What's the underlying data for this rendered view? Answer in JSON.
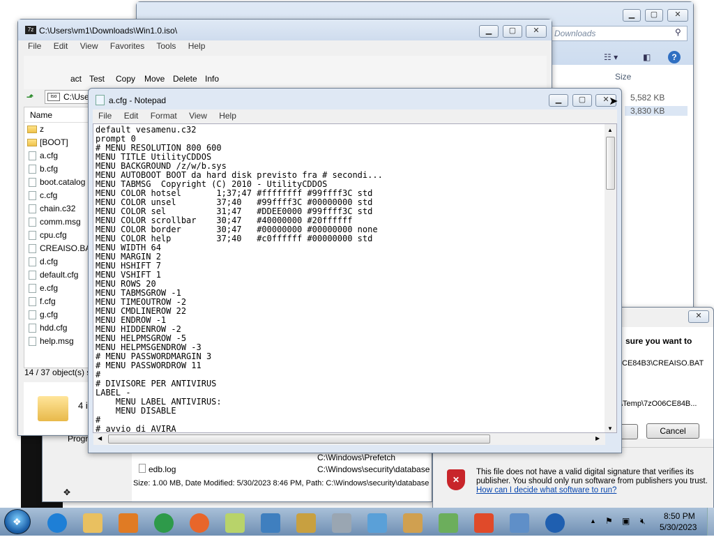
{
  "explorer": {
    "title": "C:\\Users\\vm1\\Downloads\\Win1.0.iso\\",
    "menu": [
      "File",
      "Edit",
      "View",
      "Favorites",
      "Tools",
      "Help"
    ],
    "toolbar": [
      "act",
      "Test",
      "Copy",
      "Move",
      "Delete",
      "Info"
    ],
    "path": "C:\\Use",
    "name_header": "Name",
    "files": [
      "z",
      "[BOOT]",
      "a.cfg",
      "b.cfg",
      "boot.catalog",
      "c.cfg",
      "chain.c32",
      "comm.msg",
      "cpu.cfg",
      "CREAISO.BAT",
      "d.cfg",
      "default.cfg",
      "e.cfg",
      "f.cfg",
      "g.cfg",
      "hdd.cfg",
      "help.msg"
    ],
    "status": "14 / 37 object(s) s",
    "bottom_text": "4 i"
  },
  "back_window": {
    "search_placeholder": "Downloads",
    "size_header": "Size",
    "sizes": [
      "5,582 KB",
      "3,830 KB"
    ]
  },
  "notepad": {
    "title": "a.cfg - Notepad",
    "menu": [
      "File",
      "Edit",
      "Format",
      "View",
      "Help"
    ],
    "content": "default vesamenu.c32\nprompt 0\n# MENU RESOLUTION 800 600\nMENU TITLE UtilityCDDOS\nMENU BACKGROUND /z/w/b.sys\nMENU AUTOBOOT BOOT da hard disk previsto fra # secondi...\nMENU TABMSG  Copyright (C) 2010 - UtilityCDDOS\nMENU COLOR hotsel       1;37;47 #ffffffff #99ffff3C std\nMENU COLOR unsel        37;40   #99ffff3C #00000000 std\nMENU COLOR sel          31;47   #DDEE0000 #99ffff3C std\nMENU COLOR scrollbar    30;47   #40000000 #20ffffff\nMENU COLOR border       30;47   #00000000 #00000000 none\nMENU COLOR help         37;40   #c0ffffff #00000000 std\nMENU WIDTH 64\nMENU MARGIN 2\nMENU HSHIFT 7\nMENU VSHIFT 1\nMENU ROWS 20\nMENU TABMSGROW -1\nMENU TIMEOUTROW -2\nMENU CMDLINEROW 22\nMENU ENDROW -1\nMENU HIDDENROW -2\nMENU HELPMSGROW -5\nMENU HELPMSGENDROW -3\n# MENU PASSWORDMARGIN 3\n# MENU PASSWORDROW 11\n#\n# DIVISORE PER ANTIVIRUS\nLABEL -\n    MENU LABEL ANTIVIRUS:\n    MENU DISABLE\n#\n# avvio di AVIRA"
  },
  "security_dialog": {
    "question": "sure you want to",
    "path1": "CE84B3\\CREAISO.BAT",
    "path2": "\\Temp\\7zO06CE84B...",
    "cancel": "Cancel",
    "warning": "This file does not have a valid digital signature that verifies its publisher.  You should only run software from publishers you trust.",
    "link": "How can I decide what software to run?"
  },
  "search_results": {
    "row_partial": "C:\\Windows\\Prefetch",
    "file": "edb.log",
    "file_path": "C:\\Windows\\security\\database",
    "status": "Size: 1.00 MB, Date Modified: 5/30/2023 8:46 PM, Path: C:\\Windows\\security\\database",
    "prog_label": "Progr"
  },
  "taskbar": {
    "time": "8:50 PM",
    "date": "5/30/2023",
    "icons": [
      "ie-icon",
      "explorer-icon",
      "media-player-icon",
      "chrome-icon",
      "firefox-icon",
      "sticky-notes-icon",
      "photo-viewer-icon",
      "keys-icon",
      "calculator-icon",
      "paper-plane-icon",
      "paint-icon",
      "notepad-doc-icon",
      "windows-flag-icon",
      "control-panel-icon",
      "help-icon"
    ]
  }
}
